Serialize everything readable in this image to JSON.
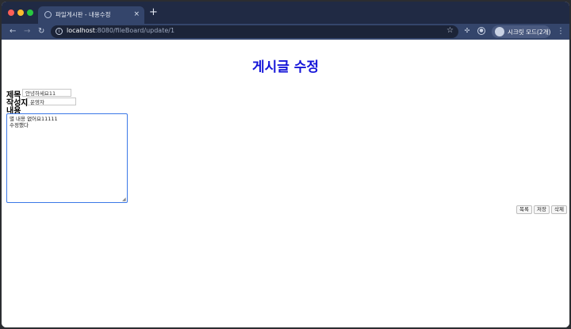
{
  "browser": {
    "tab_title": "파일게시판 - 내용수정",
    "tab_close": "×",
    "new_tab": "+",
    "url_host": "localhost",
    "url_path": ":8080/fileBoard/update/1",
    "incognito_label": "시크릿 모드(2개)"
  },
  "icons": {
    "back": "←",
    "forward": "→",
    "reload": "↻",
    "info": "i",
    "star": "☆",
    "extension_1": "✣",
    "extension_2": "●",
    "menu": "⋮"
  },
  "page": {
    "title": "게시글 수정",
    "form": {
      "title_label": "제목",
      "title_value": "안녕하세요11",
      "writer_label": "작성자",
      "writer_value": "운영자",
      "content_label": "내용",
      "content_value": "별 내용 없어요11111\n수정했다"
    },
    "buttons": {
      "list": "목록",
      "save": "저장",
      "delete": "삭제"
    }
  }
}
